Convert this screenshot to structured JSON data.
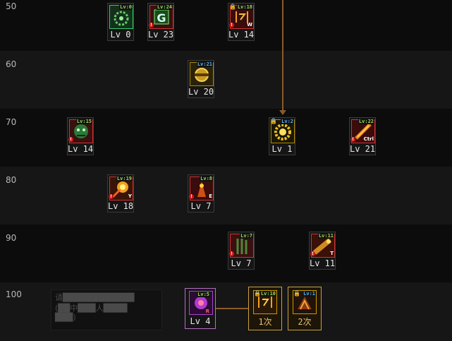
{
  "colors": {
    "row_dark": "#0c0c0c",
    "row_light": "#161616",
    "connector": "#8a5a2a",
    "gold_border": "#c9a040",
    "purple_border": "#b86ec8",
    "lv_green": "#9fd85a",
    "lv_blue": "#5ab4ff"
  },
  "level_rows": [
    {
      "label": "50"
    },
    {
      "label": "60"
    },
    {
      "label": "70"
    },
    {
      "label": "80"
    },
    {
      "label": "90"
    },
    {
      "label": "100"
    }
  ],
  "skills": [
    {
      "id": "s50a",
      "tag": "Lv:0",
      "lv_text": "Lv 0",
      "icon": "green-cog-icon",
      "palette": "green"
    },
    {
      "id": "s50b",
      "tag": "Lv:24",
      "lv_text": "Lv 23",
      "icon": "green-g-icon",
      "palette": "green-red",
      "warn": "!"
    },
    {
      "id": "s50c",
      "tag": "Lv:18",
      "lv_text": "Lv 14",
      "icon": "orange-glyph-icon",
      "palette": "red",
      "warn": "!",
      "key": "W",
      "locked": true
    },
    {
      "id": "s60a",
      "tag": "Lv:21",
      "lv_text": "Lv 20",
      "icon": "golden-orb-icon",
      "palette": "gold",
      "tag_color": "blue"
    },
    {
      "id": "s70a",
      "tag": "Lv:15",
      "lv_text": "Lv 14",
      "icon": "green-beast-icon",
      "palette": "red-green",
      "warn": "!"
    },
    {
      "id": "s70b",
      "tag": "Lv:2",
      "lv_text": "Lv 1",
      "icon": "gear-burst-icon",
      "palette": "gold-bright",
      "tag_color": "blue",
      "locked": true
    },
    {
      "id": "s70c",
      "tag": "Lv:22",
      "lv_text": "Lv 21",
      "icon": "flame-blade-icon",
      "palette": "red",
      "warn": "!",
      "key": "Ctrl"
    },
    {
      "id": "s80a",
      "tag": "Lv:19",
      "lv_text": "Lv 18",
      "icon": "fire-blast-icon",
      "palette": "red-gold",
      "warn": "!",
      "key": "Y"
    },
    {
      "id": "s80b",
      "tag": "Lv:8",
      "lv_text": "Lv 7",
      "icon": "fire-warrior-icon",
      "palette": "red",
      "warn": "!",
      "key": "E"
    },
    {
      "id": "s90a",
      "tag": "Lv:7",
      "lv_text": "Lv 7",
      "icon": "green-shard-icon",
      "palette": "red-green",
      "warn": "!"
    },
    {
      "id": "s90b",
      "tag": "Lv:11",
      "lv_text": "Lv 11",
      "icon": "golden-cannon-icon",
      "palette": "red-gold",
      "warn": "!",
      "key": "T"
    },
    {
      "id": "s100a",
      "tag": "Lv:5",
      "lv_text": "Lv 4",
      "icon": "purple-orb-icon",
      "palette": "purple",
      "key": "R",
      "border": "purple"
    },
    {
      "id": "s100b",
      "tag": "Lv:10",
      "lv_text": "1次",
      "icon": "awakening-glyph-icon",
      "palette": "gold-dark",
      "border": "gold",
      "locked": true,
      "gold_text": true
    },
    {
      "id": "s100c",
      "tag": "Lv:1",
      "lv_text": "2次",
      "icon": "awakening-beast-icon",
      "palette": "gold-dark2",
      "border": "gold",
      "tag_color": "blue",
      "locked": true,
      "gold_text": true
    }
  ],
  "background_text": {
    "line1": "请████████████",
    "line2": "(██中███人████",
    "line3": "███)"
  }
}
